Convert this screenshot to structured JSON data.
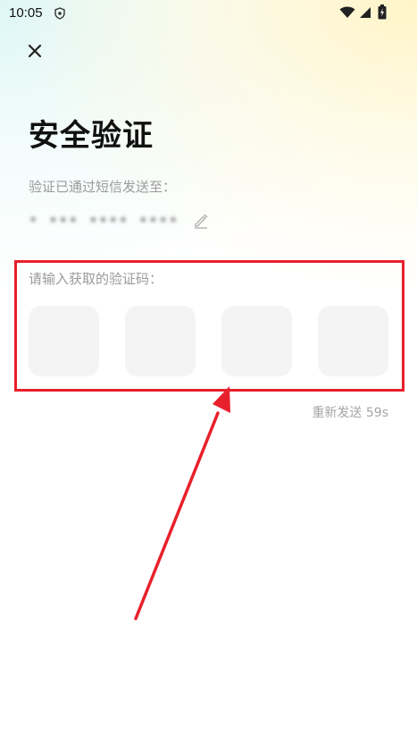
{
  "status_bar": {
    "time": "10:05",
    "icons": [
      "shield-icon",
      "wifi-icon",
      "signal-icon",
      "battery-icon"
    ]
  },
  "header": {
    "close_icon": "close-icon"
  },
  "main": {
    "title": "安全验证",
    "sms_hint": "验证已通过短信发送至：",
    "phone_number": "• ▪▪▪ ▪▪▪▪ ▪▪▪▪",
    "code_label": "请输入获取的验证码：",
    "code_inputs": [
      "",
      "",
      "",
      ""
    ],
    "resend": "重新发送 59s"
  },
  "colors": {
    "highlight": "#e8202c",
    "input_bg": "#f4f4f4",
    "muted_text": "#9a9a9a"
  }
}
